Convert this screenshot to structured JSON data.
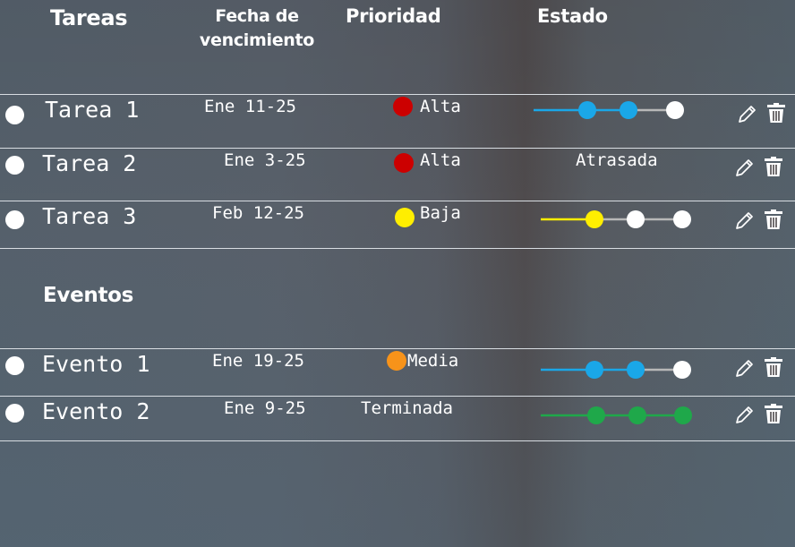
{
  "headers": {
    "tareas": "Tareas",
    "fecha": "Fecha de\nvencimiento",
    "prioridad": "Prioridad",
    "estado": "Estado"
  },
  "tasks": [
    {
      "name": "Tarea 1",
      "date": "Ene 11-25",
      "priority": "Alta",
      "priority_color": "#cc0000",
      "progress_steps_done": 2,
      "progress_color": "#1aa7e8"
    },
    {
      "name": "Tarea 2",
      "date": "Ene 3-25",
      "priority": "Alta",
      "priority_color": "#cc0000",
      "status_text": "Atrasada"
    },
    {
      "name": "Tarea 3",
      "date": "Feb 12-25",
      "priority": "Baja",
      "priority_color": "#ffee00",
      "progress_steps_done": 1,
      "progress_color": "#ffee00"
    }
  ],
  "events_title": "Eventos",
  "events": [
    {
      "name": "Evento 1",
      "date": "Ene 19-25",
      "priority": "Media",
      "priority_color": "#f7931a",
      "progress_steps_done": 2,
      "progress_color": "#1aa7e8"
    },
    {
      "name": "Evento 2",
      "date": "Ene 9-25",
      "status_text": "Terminada",
      "progress_steps_done": 3,
      "progress_color": "#1fa84a"
    }
  ],
  "icons": {
    "select": "radio-circle-icon",
    "edit": "pencil-icon",
    "delete": "trash-icon"
  },
  "colors": {
    "track_inactive": "#b8b8b8",
    "step_inactive": "#ffffff"
  }
}
